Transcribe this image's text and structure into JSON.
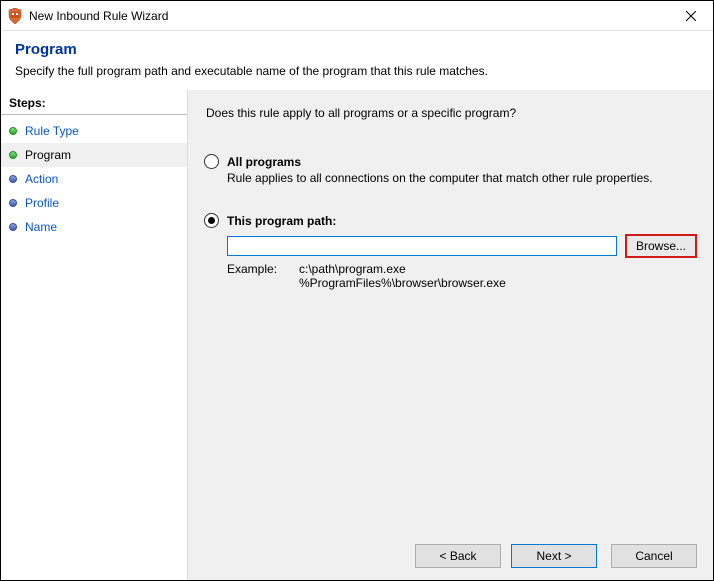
{
  "window": {
    "title": "New Inbound Rule Wizard"
  },
  "header": {
    "page_title": "Program",
    "subtitle": "Specify the full program path and executable name of the program that this rule matches."
  },
  "sidebar": {
    "heading": "Steps:",
    "items": [
      {
        "label": "Rule Type",
        "bullet": "green",
        "current": false
      },
      {
        "label": "Program",
        "bullet": "green",
        "current": true
      },
      {
        "label": "Action",
        "bullet": "blue",
        "current": false
      },
      {
        "label": "Profile",
        "bullet": "blue",
        "current": false
      },
      {
        "label": "Name",
        "bullet": "blue",
        "current": false
      }
    ]
  },
  "main": {
    "question": "Does this rule apply to all programs or a specific program?",
    "option_all": {
      "label": "All programs",
      "description": "Rule applies to all connections on the computer that match other rule properties.",
      "selected": false
    },
    "option_path": {
      "label": "This program path:",
      "selected": true,
      "value": "",
      "browse_label": "Browse...",
      "example_label": "Example:",
      "example_text": "c:\\path\\program.exe\n%ProgramFiles%\\browser\\browser.exe"
    }
  },
  "footer": {
    "back": "< Back",
    "next": "Next >",
    "cancel": "Cancel"
  }
}
